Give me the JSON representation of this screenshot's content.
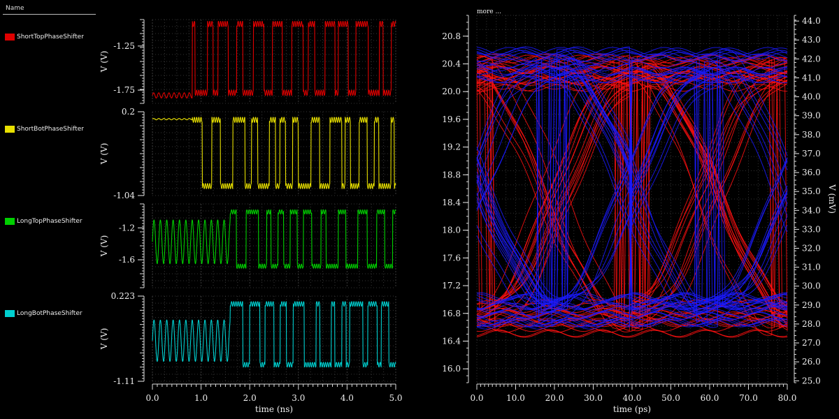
{
  "legend": {
    "header": "Name",
    "items": [
      {
        "label": "ShortTopPhaseShifter",
        "color": "#e00000"
      },
      {
        "label": "ShortBotPhaseShifter",
        "color": "#e8e000"
      },
      {
        "label": "LongTopPhaseShifter",
        "color": "#00d000"
      },
      {
        "label": "LongBotPhaseShifter",
        "color": "#00d0d0"
      }
    ]
  },
  "chart_data": [
    {
      "type": "line",
      "xlabel": "time (ns)",
      "xlim": [
        0,
        5
      ],
      "x_ticks": [
        "0.0",
        "1.0",
        "2.0",
        "3.0",
        "4.0",
        "5.0"
      ],
      "panels": [
        {
          "name": "ShortTopPhaseShifter",
          "ylabel": "V (V)",
          "color": "#e00000",
          "ylim": [
            -1.9,
            -0.95
          ],
          "y_ticks": [
            "-1.25",
            "-1.75"
          ],
          "y_tick_values": [
            -1.25,
            -1.75
          ],
          "low": -1.78,
          "high": -1.0,
          "ripple_low": [
            -1.84,
            -1.78
          ],
          "start": 0.82
        },
        {
          "name": "ShortBotPhaseShifter",
          "ylabel": "V (V)",
          "color": "#e8e000",
          "ylim": [
            -1.04,
            0.2
          ],
          "y_ticks": [
            "0.2",
            "-1.04"
          ],
          "y_tick_values": [
            0.2,
            -1.04
          ],
          "low": -0.9,
          "high": 0.08,
          "ripple_high": [
            0.08,
            0.1
          ],
          "start": 0.82
        },
        {
          "name": "LongTopPhaseShifter",
          "ylabel": "V (V)",
          "color": "#00d000",
          "ylim": [
            -1.95,
            -0.9
          ],
          "y_ticks": [
            "-1.2",
            "-1.6"
          ],
          "y_tick_values": [
            -1.2,
            -1.6
          ],
          "low": -1.68,
          "high": -1.0,
          "osc": [
            -1.65,
            -1.1
          ],
          "start": 0.0
        },
        {
          "name": "LongBotPhaseShifter",
          "ylabel": "V (V)",
          "color": "#00d0d0",
          "ylim": [
            -1.11,
            0.223
          ],
          "y_ticks": [
            "0.223",
            "-1.11"
          ],
          "y_tick_values": [
            0.223,
            -1.11
          ],
          "low": -0.85,
          "high": 0.1,
          "osc": [
            -0.8,
            -0.15
          ],
          "start": 0.0
        }
      ]
    },
    {
      "type": "eye",
      "title": "more ...",
      "xlabel": "time (ps)",
      "xlim": [
        0,
        80
      ],
      "x_ticks": [
        "0.0",
        "10.0",
        "20.0",
        "30.0",
        "40.0",
        "50.0",
        "60.0",
        "70.0",
        "80.0"
      ],
      "ylim_left": [
        15.8,
        21.1
      ],
      "y_ticks_left": [
        "16.0",
        "16.4",
        "16.8",
        "17.2",
        "17.6",
        "18.0",
        "18.4",
        "18.8",
        "19.2",
        "19.6",
        "20.0",
        "20.4",
        "20.8"
      ],
      "ylim_right": [
        24.9,
        44.3
      ],
      "y_ticks_right": [
        "25.0",
        "26.0",
        "27.0",
        "28.0",
        "29.0",
        "30.0",
        "31.0",
        "32.0",
        "33.0",
        "34.0",
        "35.0",
        "36.0",
        "37.0",
        "38.0",
        "39.0",
        "40.0",
        "41.0",
        "42.0",
        "43.0",
        "44.0"
      ],
      "ylabel_right": "V (mV)",
      "series": [
        {
          "color": "#ff1010",
          "low": 16.5,
          "high": 20.5,
          "period": 40,
          "offset": 0
        },
        {
          "color": "#1a1aff",
          "low": 16.6,
          "high": 20.6,
          "period": 40,
          "offset": 20
        }
      ]
    }
  ]
}
